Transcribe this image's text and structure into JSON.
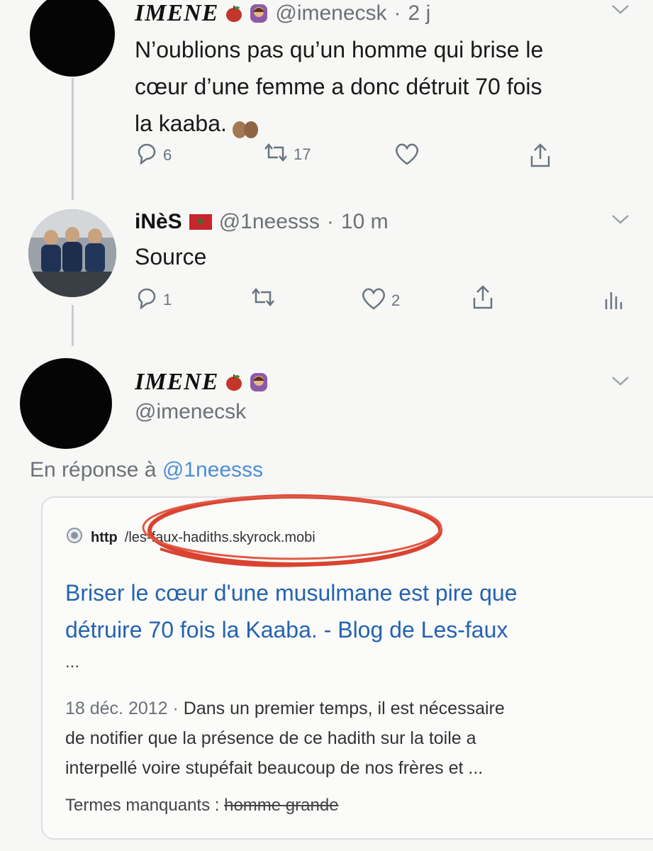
{
  "tweets": [
    {
      "display_name": "IMENE",
      "handle": "@imenecsk",
      "time": "2 j",
      "text_lines": [
        "N’oublions pas qu’un homme qui brise le",
        "cœur d’une femme a donc détruit 70 fois",
        "la kaaba."
      ],
      "replies": "6",
      "retweets": "17"
    },
    {
      "display_name": "iNèS",
      "handle": "@1neesss",
      "time": "10 m",
      "text": "Source",
      "replies": "1",
      "likes": "2"
    },
    {
      "display_name": "IMENE",
      "handle": "@imenecsk",
      "reply_label": "En réponse à",
      "reply_to": "@1neesss"
    }
  ],
  "search_result": {
    "url_prefix": "http",
    "url_domain": "/les-faux-hadiths.skyrock.mobi",
    "title_lines": [
      "Briser le cœur d'une musulmane est pire que",
      "détruire 70 fois la Kaaba. - Blog de Les-faux",
      "..."
    ],
    "date": "18 déc. 2012",
    "snippet_lines": [
      "Dans un premier temps, il est nécessaire",
      "de notifier que la présence de ce hadith sur la toile a",
      "interpellé voire stupéfait beaucoup de nos frères et ..."
    ],
    "missing_label": "Termes manquants :",
    "missing_terms": "homme grande"
  },
  "colors": {
    "link_blue": "#2563b0",
    "circle_annotation": "#d9432f",
    "flag_red": "#c8262c",
    "flag_green": "#2a7a3a"
  }
}
